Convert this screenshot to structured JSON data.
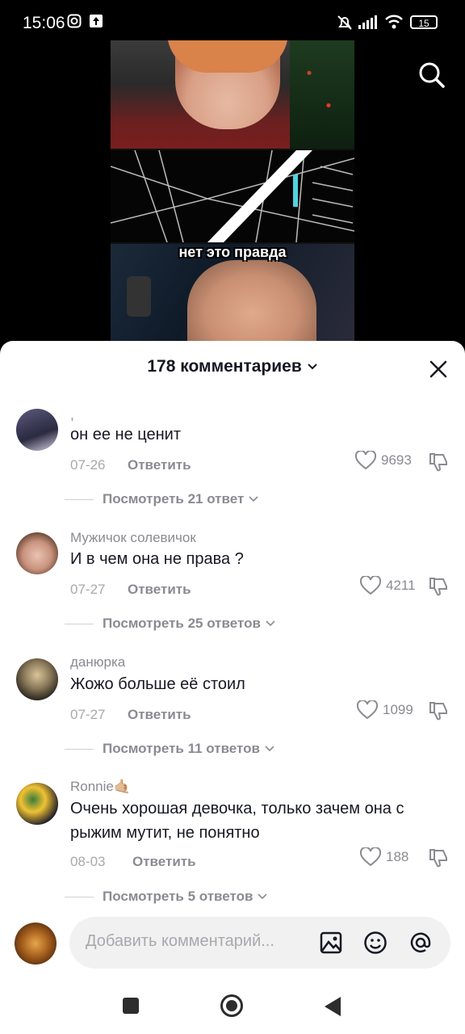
{
  "status_bar": {
    "time": "15:06",
    "battery": "15"
  },
  "video": {
    "caption": "нет это правда"
  },
  "sheet": {
    "title": "178 комментариев"
  },
  "comments": [
    {
      "user": ",",
      "text": "он ее не ценит",
      "date": "07-26",
      "reply": "Ответить",
      "likes": "9693",
      "more": "Посмотреть 21 ответ"
    },
    {
      "user": "Мужичок солевичок",
      "text": "И в чем она не права ?",
      "date": "07-27",
      "reply": "Ответить",
      "likes": "4211",
      "more": "Посмотреть 25 ответов"
    },
    {
      "user": "данюрка",
      "text": "Жожо больше её стоил",
      "date": "07-27",
      "reply": "Ответить",
      "likes": "1099",
      "more": "Посмотреть 11 ответов"
    },
    {
      "user": "Ronnie🤙🏼",
      "text": "Очень хорошая девочка, только зачем она с рыжим мутит, не понятно",
      "date": "08-03",
      "reply": "Ответить",
      "likes": "188",
      "more": "Посмотреть 5 ответов"
    }
  ],
  "input": {
    "placeholder": "Добавить комментарий..."
  },
  "icons": {
    "search": "search-icon",
    "close": "close-icon",
    "like": "heart-icon",
    "dislike": "dislike-icon",
    "image": "image-icon",
    "emoji": "emoji-icon",
    "mention": "at-icon",
    "nav_recents": "square-icon",
    "nav_home": "circle-icon",
    "nav_back": "triangle-icon"
  },
  "colors": {
    "sheet_bg": "#ffffff",
    "text_primary": "#161823",
    "text_secondary": "#8a8b91"
  }
}
